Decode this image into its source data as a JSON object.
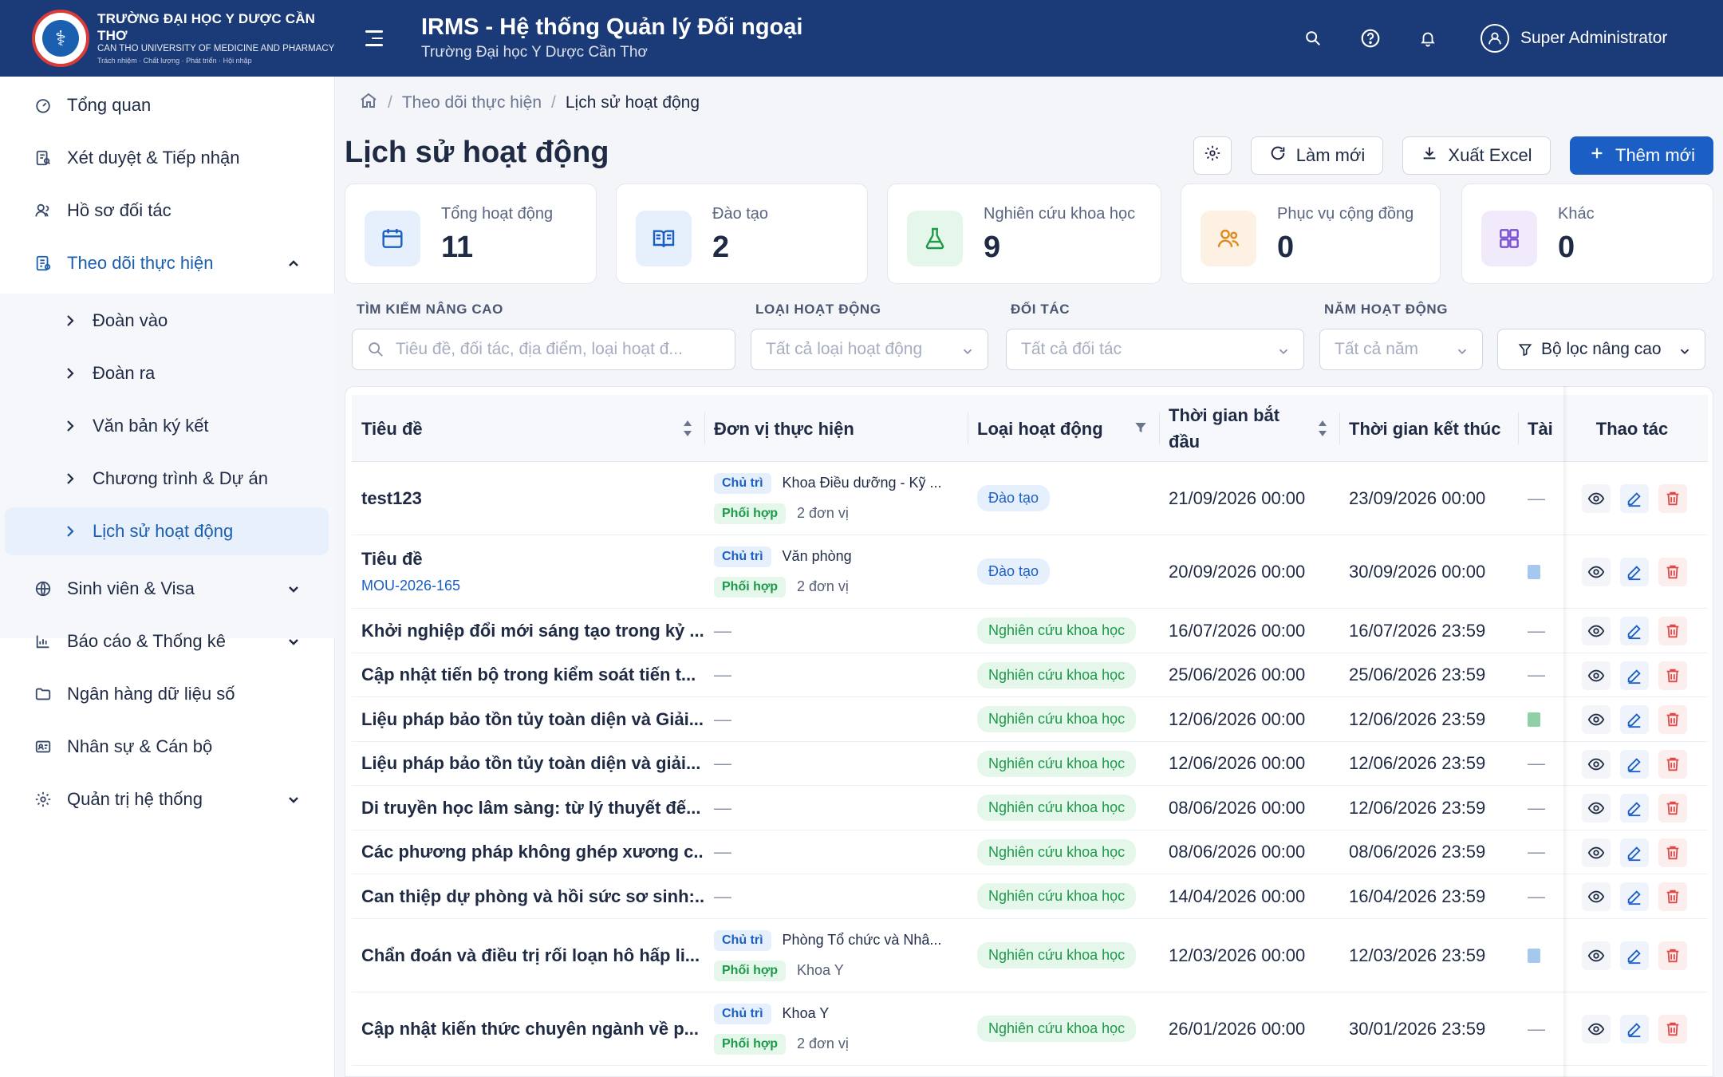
{
  "header": {
    "brand_line1": "TRƯỜNG ĐẠI HỌC Y DƯỢC CẦN THƠ",
    "brand_line2": "CAN THO UNIVERSITY OF MEDICINE AND PHARMACY",
    "brand_line3": "Trách nhiệm · Chất lượng · Phát triển · Hội nhập",
    "app_title": "IRMS - Hệ thống Quản lý Đối ngoại",
    "app_subtitle": "Trường Đại học Y Dược Cần Thơ",
    "user_name": "Super Administrator"
  },
  "sidebar": {
    "items": [
      {
        "label": "Tổng quan",
        "icon": "dashboard-icon"
      },
      {
        "label": "Xét duyệt & Tiếp nhận",
        "icon": "review-icon"
      },
      {
        "label": "Hồ sơ đối tác",
        "icon": "partner-icon"
      },
      {
        "label": "Theo dõi thực hiện",
        "icon": "tracking-icon",
        "expanded": true
      },
      {
        "label": "Sinh viên & Visa",
        "icon": "globe-icon"
      },
      {
        "label": "Báo cáo & Thống kê",
        "icon": "bar-chart-icon"
      },
      {
        "label": "Ngân hàng dữ liệu số",
        "icon": "folder-icon"
      },
      {
        "label": "Nhân sự & Cán bộ",
        "icon": "id-card-icon"
      },
      {
        "label": "Quản trị hệ thống",
        "icon": "gear-icon"
      }
    ],
    "sub_items": [
      "Đoàn vào",
      "Đoàn ra",
      "Văn bản ký kết",
      "Chương trình & Dự án",
      "Lịch sử hoạt động"
    ]
  },
  "breadcrumb": {
    "parent": "Theo dõi thực hiện",
    "current": "Lịch sử hoạt động"
  },
  "page": {
    "title": "Lịch sử hoạt động",
    "refresh_label": "Làm mới",
    "export_label": "Xuất Excel",
    "add_label": "Thêm mới"
  },
  "stats": [
    {
      "label": "Tổng hoạt động",
      "value": "11",
      "color": "#1b5fc4",
      "bg": "#e6f0fd"
    },
    {
      "label": "Đào tạo",
      "value": "2",
      "color": "#1b5fc4",
      "bg": "#e6f0fd"
    },
    {
      "label": "Nghiên cứu khoa học",
      "value": "9",
      "color": "#1c9a49",
      "bg": "#e5f7ea"
    },
    {
      "label": "Phục vụ cộng đồng",
      "value": "0",
      "color": "#e08a1e",
      "bg": "#fdf1e3"
    },
    {
      "label": "Khác",
      "value": "0",
      "color": "#7a4fd0",
      "bg": "#f0eafb"
    }
  ],
  "filters": {
    "search_label": "TÌM KIẾM NÂNG CAO",
    "search_placeholder": "Tiêu đề, đối tác, địa điểm, loại hoạt đ...",
    "type_label": "LOẠI HOẠT ĐỘNG",
    "type_value": "Tất cả loại hoạt động",
    "partner_label": "ĐỐI TÁC",
    "partner_value": "Tất cả đối tác",
    "year_label": "NĂM HOẠT ĐỘNG",
    "year_value": "Tất cả năm",
    "advanced_label": "Bộ lọc nâng cao"
  },
  "table": {
    "columns": {
      "title": "Tiêu đề",
      "unit": "Đơn vị thực hiện",
      "type": "Loại hoạt động",
      "start_line1": "Thời gian bắt",
      "start_line2": "đầu",
      "end": "Thời gian kết thúc",
      "files": "Tài",
      "actions": "Thao tác"
    },
    "tag_main": "Chủ trì",
    "tag_co": "Phối hợp",
    "rows": [
      {
        "title": "test123",
        "code": "",
        "main_unit": "Khoa Điều dưỡng - Kỹ ...",
        "co_unit": "2 đơn vị",
        "type": "Đào tạo",
        "start": "21/09/2026 00:00",
        "end": "23/09/2026 00:00",
        "file": "—"
      },
      {
        "title": "Tiêu đề",
        "code": "MOU-2026-165",
        "main_unit": "Văn phòng",
        "co_unit": "2 đơn vị",
        "type": "Đào tạo",
        "start": "20/09/2026 00:00",
        "end": "30/09/2026 00:00",
        "file": "doc"
      },
      {
        "title": "Khởi nghiệp đổi mới sáng tạo trong kỷ ...",
        "code": "",
        "main_unit": "",
        "co_unit": "",
        "type": "Nghiên cứu khoa học",
        "start": "16/07/2026 00:00",
        "end": "16/07/2026 23:59",
        "file": "—"
      },
      {
        "title": "Cập nhật tiến bộ trong kiểm soát tiến t...",
        "code": "",
        "main_unit": "",
        "co_unit": "",
        "type": "Nghiên cứu khoa học",
        "start": "25/06/2026 00:00",
        "end": "25/06/2026 23:59",
        "file": "—"
      },
      {
        "title": "Liệu pháp bảo tồn tủy toàn diện và Giải...",
        "code": "",
        "main_unit": "",
        "co_unit": "",
        "type": "Nghiên cứu khoa học",
        "start": "12/06/2026 00:00",
        "end": "12/06/2026 23:59",
        "file": "xls"
      },
      {
        "title": "Liệu pháp bảo tồn tủy toàn diện và giải...",
        "code": "",
        "main_unit": "",
        "co_unit": "",
        "type": "Nghiên cứu khoa học",
        "start": "12/06/2026 00:00",
        "end": "12/06/2026 23:59",
        "file": "—"
      },
      {
        "title": "Di truyền học lâm sàng: từ lý thuyết đế...",
        "code": "",
        "main_unit": "",
        "co_unit": "",
        "type": "Nghiên cứu khoa học",
        "start": "08/06/2026 00:00",
        "end": "12/06/2026 23:59",
        "file": "—"
      },
      {
        "title": "Các phương pháp không ghép xương c...",
        "code": "",
        "main_unit": "",
        "co_unit": "",
        "type": "Nghiên cứu khoa học",
        "start": "08/06/2026 00:00",
        "end": "08/06/2026 23:59",
        "file": "—"
      },
      {
        "title": "Can thiệp dự phòng và hồi sức sơ sinh:...",
        "code": "",
        "main_unit": "",
        "co_unit": "",
        "type": "Nghiên cứu khoa học",
        "start": "14/04/2026 00:00",
        "end": "16/04/2026 23:59",
        "file": "—"
      },
      {
        "title": "Chẩn đoán và điều trị rối loạn hô hấp li...",
        "code": "",
        "main_unit": "Phòng Tổ chức và Nhâ...",
        "co_unit": "Khoa Y",
        "type": "Nghiên cứu khoa học",
        "start": "12/03/2026 00:00",
        "end": "12/03/2026 23:59",
        "file": "doc"
      },
      {
        "title": "Cập nhật kiến thức chuyên ngành về p...",
        "code": "",
        "main_unit": "Khoa Y",
        "co_unit": "2 đơn vị",
        "type": "Nghiên cứu khoa học",
        "start": "26/01/2026 00:00",
        "end": "30/01/2026 23:59",
        "file": "—"
      }
    ]
  }
}
